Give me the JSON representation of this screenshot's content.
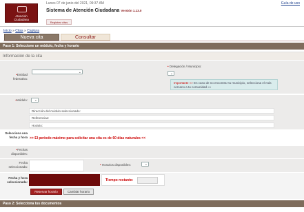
{
  "header": {
    "date": "Lunes 07 de junio del 2021, 09:37 AM",
    "help": "Guía de uso",
    "title": "Sistema de Atención Ciudadana",
    "version": "Versión 1.13.0",
    "logo_line1": "Atención",
    "logo_line2": "Ciudadana",
    "small_button": "Registrar citas"
  },
  "breadcrumb": {
    "home": "Inicio",
    "sep1": " » ",
    "citas": "Citas",
    "sep2": " » ",
    "current": "Captura"
  },
  "tabs": [
    {
      "label": "Nueva cita"
    },
    {
      "label": "Consultar"
    }
  ],
  "step1": {
    "label": "Paso 1: Seleccione un módulo, fecha y horario"
  },
  "section": {
    "title": "Información de la cita"
  },
  "form": {
    "entidad_label": "Entidad federativa:",
    "delegacion_label": "Delegación / Municipio:",
    "note_important": "Importante »» ",
    "note_text": "En caso de no encontrar tu municipio, selecciona el más cercano a tu comunidad ««",
    "modulo_label": "Módulo:",
    "direccion_label": "Dirección del módulo seleccionado:",
    "referencias_label": "Referencias:",
    "horario_label": "Horario:",
    "selecciona_label": "Selecciona una fecha y hora",
    "periodo_warning": ">> El periodo máximo para solicitar una cita es de 60 días naturales <<",
    "fechas_label": "Fechas disponibles:",
    "fecha_sel_label": "Fecha seleccionada:",
    "horarios_label": "Horarios disponibles:",
    "fecha_hora_label": "Fecha y hora seleccionada:",
    "tiempo_label": "Tiempo restante:",
    "reservar_button": "Reservar horario",
    "cambiar_button": "Cambiar horario"
  },
  "step2": {
    "label": "Paso 2: Selecciona tus documentos"
  }
}
